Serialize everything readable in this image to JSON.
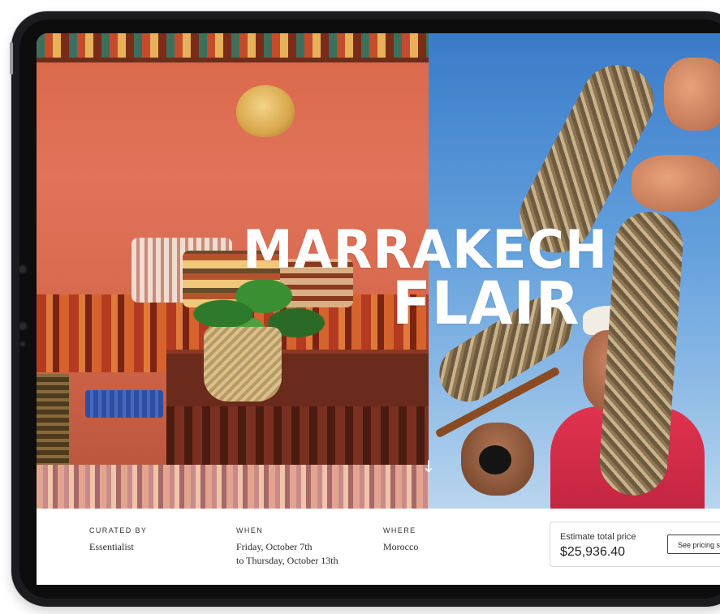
{
  "hero": {
    "title_line_1": "MARRAKECH",
    "title_line_2": "FLAIR",
    "scroll_glyph": "↓"
  },
  "trip": {
    "curated_by": {
      "label": "CURATED BY",
      "value": "Essentialist"
    },
    "when": {
      "label": "WHEN",
      "line_1": "Friday, October 7th",
      "line_2": "to Thursday, October 13th"
    },
    "where": {
      "label": "WHERE",
      "value": "Morocco"
    }
  },
  "pricing": {
    "label": "Estimate total price",
    "value": "$25,936.40",
    "button_label": "See pricing s"
  },
  "colors": {
    "device_frame": "#1c1c1e",
    "title": "#ffffff",
    "info_bg": "#ffffff"
  },
  "icons": {
    "scroll": "arrow-down-icon"
  }
}
